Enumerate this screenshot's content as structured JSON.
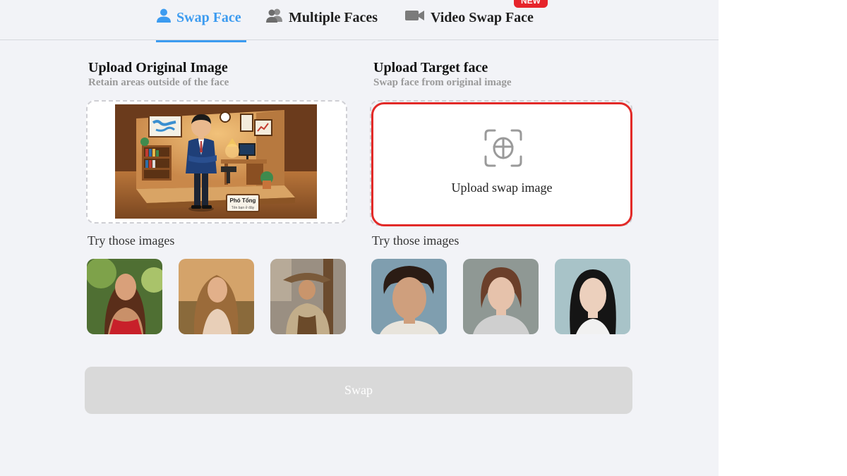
{
  "tabs": [
    {
      "label": "Swap Face",
      "icon": "user-icon",
      "active": true
    },
    {
      "label": "Multiple Faces",
      "icon": "users-icon",
      "active": false
    },
    {
      "label": "Video Swap Face",
      "icon": "video-camera-icon",
      "active": false
    }
  ],
  "badge": {
    "label": "NEW"
  },
  "original": {
    "title": "Upload Original Image",
    "subtitle": "Retain areas outside of the face",
    "nameplate_line1": "Phó Tổng",
    "nameplate_line2": "Tên bạn ở đây",
    "try_label": "Try those images"
  },
  "target": {
    "title": "Upload Target face",
    "subtitle": "Swap face from original image",
    "upload_label": "Upload swap image",
    "try_label": "Try those images"
  },
  "swap_button": {
    "label": "Swap"
  },
  "colors": {
    "accent": "#3c9bf0",
    "highlight": "#e22a28",
    "panel_bg": "#f2f3f7",
    "button_disabled": "#d9d9d9"
  }
}
